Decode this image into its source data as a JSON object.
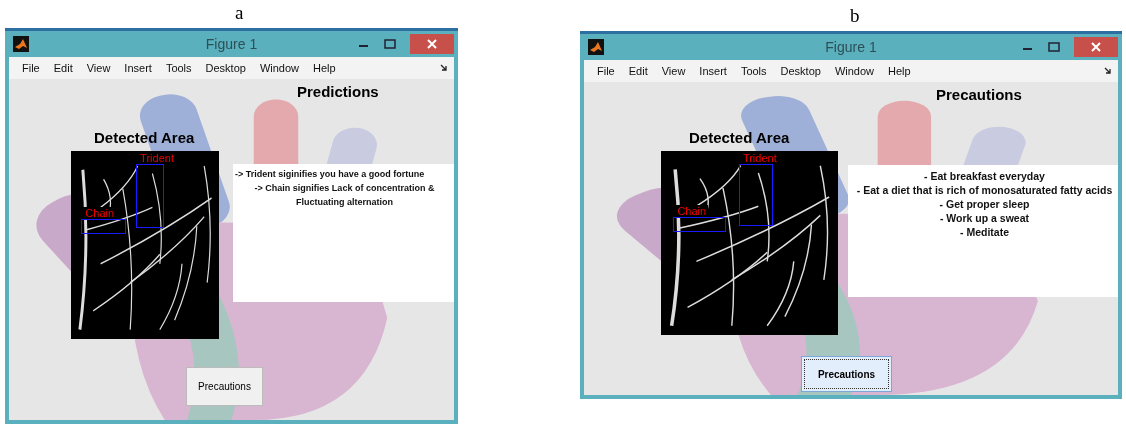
{
  "panels": [
    {
      "caption": "a",
      "window": {
        "title": "Figure 1",
        "menu": [
          "File",
          "Edit",
          "View",
          "Insert",
          "Tools",
          "Desktop",
          "Window",
          "Help"
        ],
        "heading": "Predictions",
        "image_title": "Detected Area",
        "regions": [
          {
            "label": "Trident"
          },
          {
            "label": "Chain"
          }
        ],
        "text_lines": [
          {
            "kind": "left",
            "text": "-> Trident siginifies you have a good fortune"
          },
          {
            "kind": "center",
            "text": "-> Chain signifies Lack of concentration &"
          },
          {
            "kind": "center",
            "text": "Fluctuating alternation"
          }
        ],
        "button": {
          "label": "Precautions",
          "focused": false
        }
      }
    },
    {
      "caption": "b",
      "window": {
        "title": "Figure 1",
        "menu": [
          "File",
          "Edit",
          "View",
          "Insert",
          "Tools",
          "Desktop",
          "Window",
          "Help"
        ],
        "heading": "Precautions",
        "image_title": "Detected Area",
        "regions": [
          {
            "label": "Trident"
          },
          {
            "label": "Chain"
          }
        ],
        "text_lines": [
          {
            "kind": "center",
            "text": "- Eat breakfast everyday"
          },
          {
            "kind": "center",
            "text": "- Eat a diet that is rich of monosaturated fatty acids"
          },
          {
            "kind": "center",
            "text": "- Get proper sleep"
          },
          {
            "kind": "center",
            "text": "- Work up a sweat"
          },
          {
            "kind": "center",
            "text": "- Meditate"
          }
        ],
        "button": {
          "label": "Precautions",
          "focused": true
        }
      }
    }
  ]
}
